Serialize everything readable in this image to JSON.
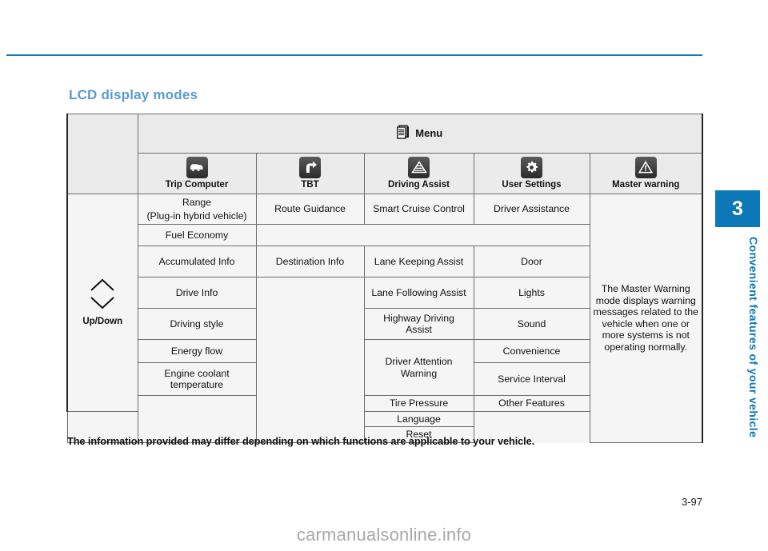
{
  "page": {
    "number": "3-97",
    "chapter_number": "3",
    "chapter_title": "Convenient features of your vehicle",
    "watermark": "carmanualsonline.info",
    "accent_color": "#0d78b7",
    "heading_color": "#5a9bd0"
  },
  "section": {
    "heading": "LCD display modes"
  },
  "table": {
    "menu_label": "Menu",
    "menu_icon": "documents-stack-icon",
    "corner_label": "",
    "updown": {
      "label": "Up/Down",
      "up_icon": "chevron-up-icon",
      "down_icon": "chevron-down-icon"
    },
    "columns": [
      {
        "label": "Trip Computer",
        "icon": "trip-computer-icon"
      },
      {
        "label": "TBT",
        "icon": "turn-by-turn-arrow-icon"
      },
      {
        "label": "Driving Assist",
        "icon": "lane-road-icon"
      },
      {
        "label": "User Settings",
        "icon": "gear-icon"
      },
      {
        "label": "Master warning",
        "icon": "warning-triangle-icon"
      }
    ],
    "trip_computer": [
      "Range\n(Plug-in hybrid vehicle)",
      "Fuel Economy",
      "Accumulated Info",
      "Drive Info",
      "Driving style",
      "Energy flow",
      "Engine coolant temperature"
    ],
    "trip_computer_rows": {
      "range": "Range",
      "range_sub": "(Plug-in hybrid vehicle)",
      "fuel_economy": "Fuel Economy",
      "accumulated_info": "Accumulated Info",
      "drive_info": "Drive Info",
      "driving_style": "Driving style",
      "energy_flow": "Energy flow",
      "engine_coolant_1": "Engine coolant",
      "engine_coolant_2": "temperature"
    },
    "tbt": {
      "route_guidance": "Route Guidance",
      "destination_info": "Destination Info"
    },
    "driving_assist": {
      "smart_cruise_control": "Smart Cruise Control",
      "lane_keeping_assist": "Lane Keeping Assist",
      "lane_following_assist": "Lane Following Assist",
      "highway_driving_assist_1": "Highway Driving",
      "highway_driving_assist_2": "Assist",
      "driver_attention_warning_1": "Driver Attention",
      "driver_attention_warning_2": "Warning",
      "tire_pressure": "Tire Pressure"
    },
    "user_settings": {
      "driver_assistance": "Driver Assistance",
      "door": "Door",
      "lights": "Lights",
      "sound": "Sound",
      "convenience": "Convenience",
      "service_interval": "Service Interval",
      "other_features": "Other Features",
      "language": "Language",
      "reset": "Reset"
    },
    "master_warning": {
      "description": "The Master Warning mode displays warning messages related to the vehicle when one or more systems is not operating normally."
    },
    "caption": "The information provided may differ depending on which functions are applicable to your vehicle."
  }
}
